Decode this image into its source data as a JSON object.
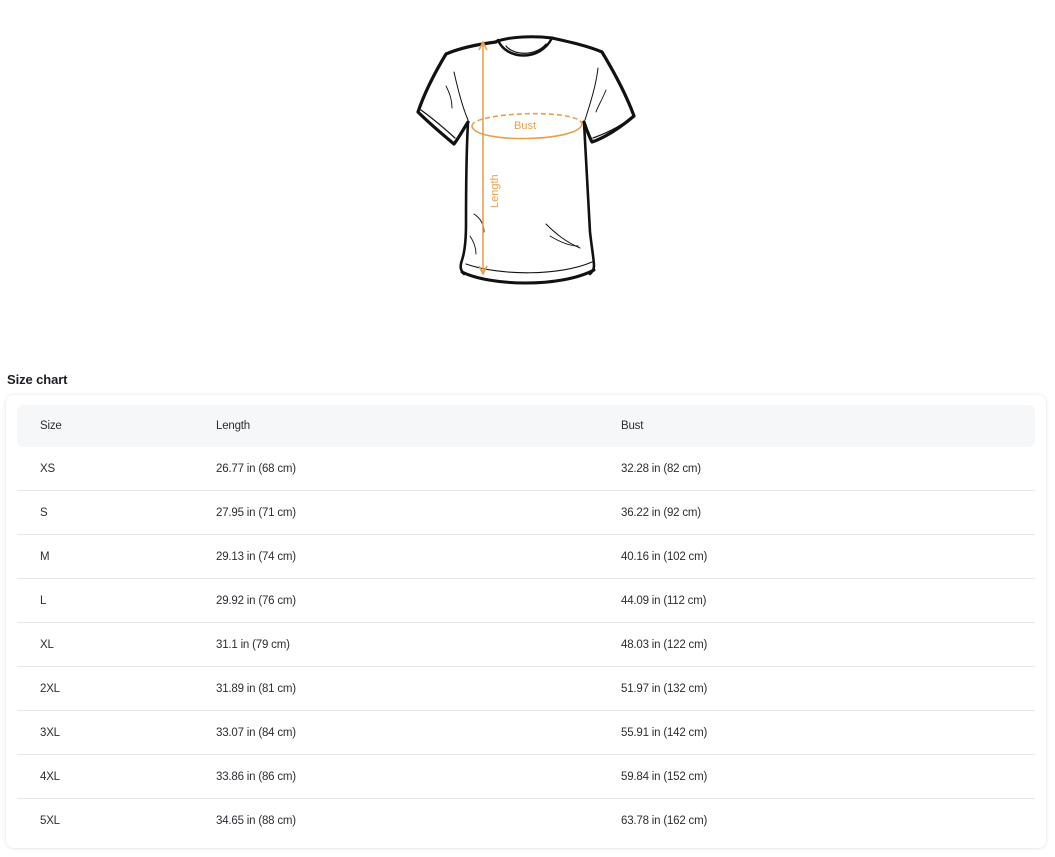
{
  "diagram": {
    "bust_label": "Bust",
    "length_label": "Length",
    "accent_color": "#e9a04a"
  },
  "size_chart": {
    "title": "Size chart",
    "columns": [
      "Size",
      "Length",
      "Bust"
    ],
    "rows": [
      {
        "size": "XS",
        "length": "26.77 in  (68 cm)",
        "bust": "32.28 in  (82 cm)"
      },
      {
        "size": "S",
        "length": "27.95 in  (71 cm)",
        "bust": "36.22 in  (92 cm)"
      },
      {
        "size": "M",
        "length": "29.13 in  (74 cm)",
        "bust": "40.16 in  (102 cm)"
      },
      {
        "size": "L",
        "length": "29.92 in  (76 cm)",
        "bust": "44.09 in  (112 cm)"
      },
      {
        "size": "XL",
        "length": "31.1 in  (79 cm)",
        "bust": "48.03 in  (122 cm)"
      },
      {
        "size": "2XL",
        "length": "31.89 in  (81 cm)",
        "bust": "51.97 in  (132 cm)"
      },
      {
        "size": "3XL",
        "length": "33.07 in  (84 cm)",
        "bust": "55.91 in  (142 cm)"
      },
      {
        "size": "4XL",
        "length": "33.86 in  (86 cm)",
        "bust": "59.84 in  (152 cm)"
      },
      {
        "size": "5XL",
        "length": "34.65 in  (88 cm)",
        "bust": "63.78 in  (162 cm)"
      }
    ]
  }
}
